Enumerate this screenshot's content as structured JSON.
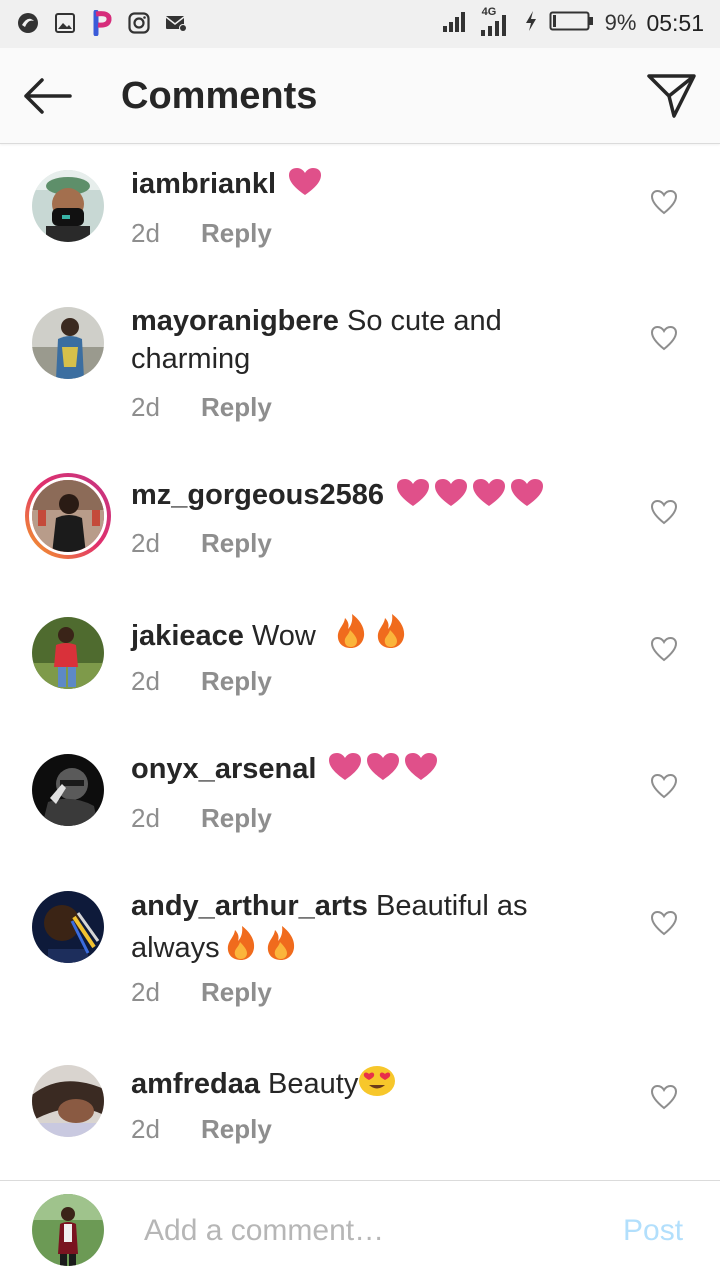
{
  "status_bar": {
    "network": "4G",
    "battery": "9%",
    "time": "05:51"
  },
  "header": {
    "title": "Comments"
  },
  "comments": [
    {
      "username": "iambriankl",
      "text": "",
      "emojis": [
        "heart"
      ],
      "age": "2d",
      "reply_label": "Reply"
    },
    {
      "username": "mayoranigbere",
      "text": "So cute and charming",
      "emojis": [],
      "age": "2d",
      "reply_label": "Reply"
    },
    {
      "username": "mz_gorgeous2586",
      "text": "",
      "emojis": [
        "heart",
        "heart",
        "heart",
        "heart"
      ],
      "age": "2d",
      "reply_label": "Reply"
    },
    {
      "username": "jakieace",
      "text": "Wow",
      "emojis": [
        "fire",
        "fire"
      ],
      "age": "2d",
      "reply_label": "Reply"
    },
    {
      "username": "onyx_arsenal",
      "text": "",
      "emojis": [
        "heart",
        "heart",
        "heart"
      ],
      "age": "2d",
      "reply_label": "Reply"
    },
    {
      "username": "andy_arthur_arts",
      "text": "Beautiful as always",
      "emojis": [
        "fire",
        "fire"
      ],
      "age": "2d",
      "reply_label": "Reply"
    },
    {
      "username": "amfredaa",
      "text": "Beauty",
      "emojis": [
        "heart-eyes"
      ],
      "age": "2d",
      "reply_label": "Reply"
    }
  ],
  "composer": {
    "placeholder": "Add a comment…",
    "post_label": "Post"
  },
  "colors": {
    "heart_emoji": "#e0508a",
    "post_disabled": "#b2dffc",
    "meta_text": "#8e8e8e"
  }
}
